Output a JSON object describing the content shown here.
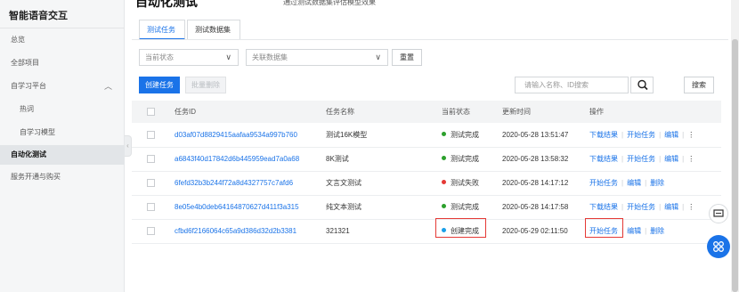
{
  "sidebar": {
    "title": "智能语音交互",
    "items": [
      {
        "label": "总览"
      },
      {
        "label": "全部项目"
      },
      {
        "label": "自学习平台",
        "caret": "︿"
      },
      {
        "label": "热词"
      },
      {
        "label": "自学习模型"
      },
      {
        "label": "自动化测试"
      },
      {
        "label": "服务开通与购买"
      }
    ]
  },
  "header": {
    "title": "自动化测试",
    "subtitle": "通过测试数据集评估模型效果"
  },
  "tabs": [
    {
      "label": "测试任务"
    },
    {
      "label": "测试数据集"
    }
  ],
  "filters": {
    "status_placeholder": "当前状态",
    "dataset_placeholder": "关联数据集",
    "reset_label": "重置"
  },
  "toolbar": {
    "create_label": "创建任务",
    "batch_delete_label": "批量删除",
    "search_placeholder": "请输入名称、ID搜索",
    "search_label": "搜索"
  },
  "table": {
    "columns": [
      "任务ID",
      "任务名称",
      "当前状态",
      "更新时间",
      "操作"
    ],
    "rows": [
      {
        "id": "d03af07d8829415aafaa9534a997b760",
        "name": "测试16K模型",
        "status": "测试完成",
        "status_color": "#2ca02c",
        "time": "2020-05-28 13:51:47",
        "ops": [
          "下载结果",
          "开始任务",
          "编辑"
        ],
        "more": "⋮"
      },
      {
        "id": "a6843f40d17842d6b445959ead7a0a68",
        "name": "8K测试",
        "status": "测试完成",
        "status_color": "#2ca02c",
        "time": "2020-05-28 13:58:32",
        "ops": [
          "下载结果",
          "开始任务",
          "编辑"
        ],
        "more": "⋮"
      },
      {
        "id": "6fefd32b3b244f72a8d4327757c7afd6",
        "name": "文言文测试",
        "status": "测试失败",
        "status_color": "#e53935",
        "time": "2020-05-28 14:17:12",
        "ops": [
          "开始任务",
          "编辑",
          "删除"
        ],
        "more": ""
      },
      {
        "id": "8e05e4b0deb64164870627d411f3a315",
        "name": "纯文本测试",
        "status": "测试完成",
        "status_color": "#2ca02c",
        "time": "2020-05-28 14:17:58",
        "ops": [
          "下载结果",
          "开始任务",
          "编辑"
        ],
        "more": "⋮"
      },
      {
        "id": "cfbd6f2166064c65a9d386d32d2b3381",
        "name": "321321",
        "status": "创建完成",
        "status_color": "#1a9fe8",
        "time": "2020-05-29 02:11:50",
        "ops": [
          "开始任务",
          "编辑",
          "删除"
        ],
        "more": ""
      }
    ]
  },
  "colors": {
    "accent": "#1a73e8",
    "highlight": "#e53935"
  },
  "icons": {
    "chevron": "chevron-down-icon",
    "search": "search-icon",
    "chat": "chat-icon",
    "apps": "apps-icon"
  }
}
